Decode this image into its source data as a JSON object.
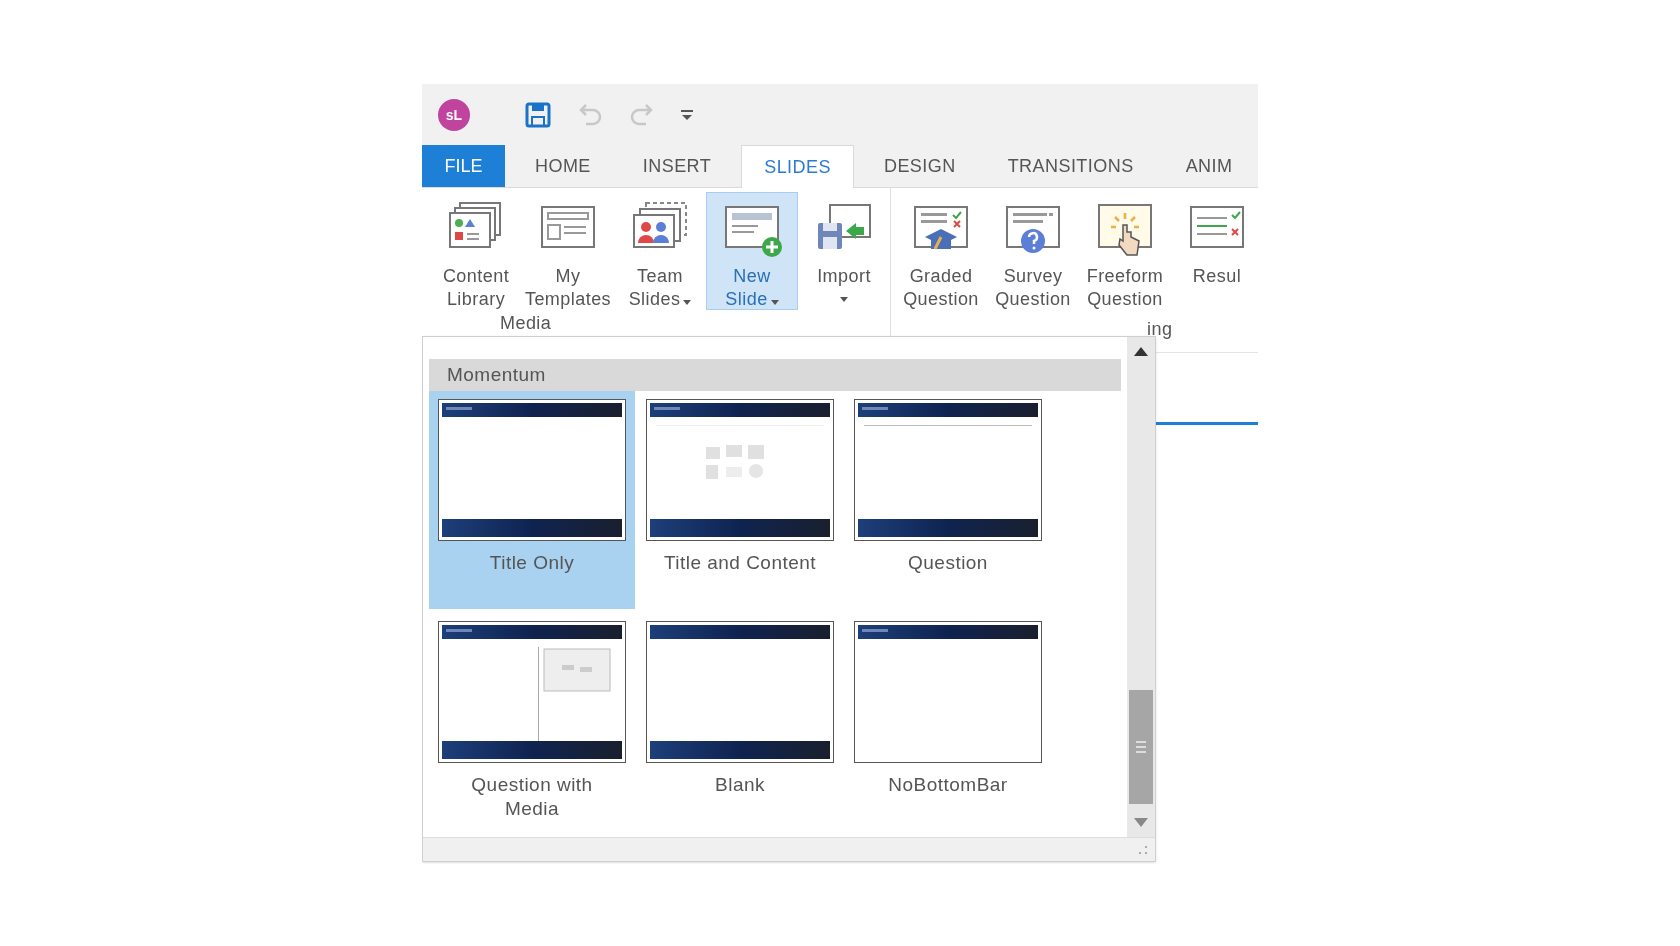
{
  "quick_access": {
    "avatar": "sL",
    "tools": [
      {
        "kind": "save",
        "disabled": false
      },
      {
        "kind": "undo",
        "disabled": true
      },
      {
        "kind": "redo",
        "disabled": true
      },
      {
        "kind": "customize",
        "disabled": false
      }
    ]
  },
  "tabs": [
    {
      "label": "FILE",
      "kind": "file",
      "selected": false
    },
    {
      "label": "HOME",
      "kind": "tab",
      "selected": false
    },
    {
      "label": "INSERT",
      "kind": "tab",
      "selected": false
    },
    {
      "label": "SLIDES",
      "kind": "tab",
      "selected": true
    },
    {
      "label": "DESIGN",
      "kind": "tab",
      "selected": false
    },
    {
      "label": "TRANSITIONS",
      "kind": "tab",
      "selected": false
    },
    {
      "label": "ANIM",
      "kind": "tab",
      "selected": false
    }
  ],
  "ribbon": {
    "groups": [
      {
        "label": "Media",
        "buttons": [
          {
            "kind": "library",
            "lines": [
              "Content",
              "Library"
            ],
            "dropdown": false,
            "selected": false
          },
          {
            "kind": "template",
            "lines": [
              "My",
              "Templates"
            ],
            "dropdown": false,
            "selected": false
          },
          {
            "kind": "team",
            "lines": [
              "Team",
              "Slides"
            ],
            "dropdown": true,
            "selected": false
          },
          {
            "kind": "new-slide",
            "lines": [
              "New",
              "Slide"
            ],
            "dropdown": true,
            "selected": true
          },
          {
            "kind": "import",
            "lines": [
              "Import"
            ],
            "dropdown": true,
            "selected": false
          }
        ]
      },
      {
        "label": "ing",
        "buttons": [
          {
            "kind": "graded",
            "lines": [
              "Graded",
              "Question"
            ],
            "dropdown": false,
            "selected": false
          },
          {
            "kind": "survey",
            "lines": [
              "Survey",
              "Question"
            ],
            "dropdown": false,
            "selected": false
          },
          {
            "kind": "freeform",
            "lines": [
              "Freeform",
              "Question"
            ],
            "dropdown": false,
            "selected": false
          },
          {
            "kind": "result",
            "lines": [
              "Resul"
            ],
            "dropdown": false,
            "selected": false
          }
        ]
      }
    ]
  },
  "gallery": {
    "title": "Momentum",
    "items": [
      {
        "label": "Title Only",
        "kind": "title-only",
        "selected": true
      },
      {
        "label": "Title and Content",
        "kind": "title-content",
        "selected": false
      },
      {
        "label": "Question",
        "kind": "question",
        "selected": false
      },
      {
        "label": "Question with Media",
        "kind": "question-media",
        "selected": false
      },
      {
        "label": "Blank",
        "kind": "blank",
        "selected": false
      },
      {
        "label": "NoBottomBar",
        "kind": "no-bottom",
        "selected": false
      }
    ]
  }
}
